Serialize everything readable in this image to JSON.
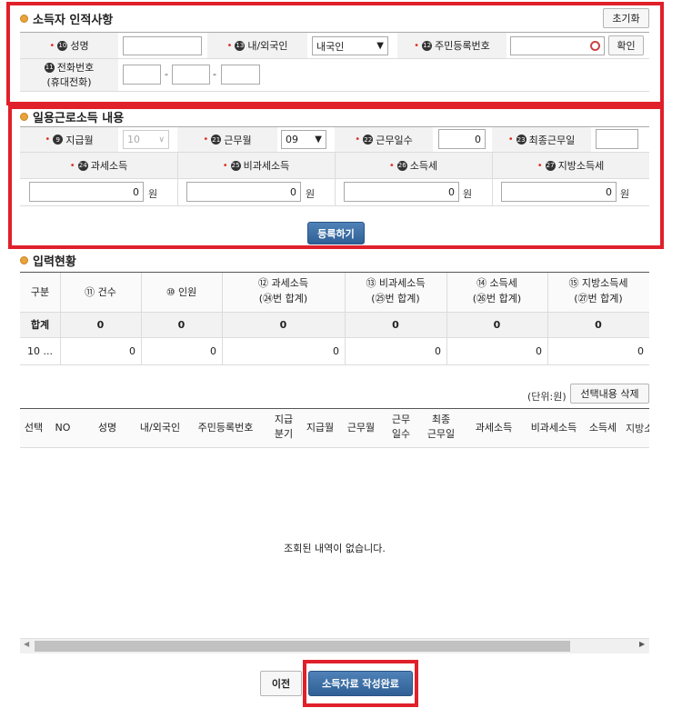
{
  "section1": {
    "title": "소득자 인적사항",
    "reset_button": "초기화",
    "name_label": "성명",
    "name_num": "⑩",
    "nationality_label": "내/외국인",
    "nationality_num": "⑬",
    "nationality_value": "내국인",
    "resident_label": "주민등록번호",
    "resident_num": "⑫",
    "confirm_button": "확인",
    "phone_label_1": "전화번호",
    "phone_label_2": "(휴대전화)",
    "phone_num": "⑪",
    "dash": "-"
  },
  "section2": {
    "title": "일용근로소득 내용",
    "paymonth_label": "지급월",
    "paymonth_num": "⑨",
    "paymonth_value": "10",
    "workmonth_label": "근무월",
    "workmonth_num": "㉑",
    "workmonth_value": "09",
    "workdays_label": "근무일수",
    "workdays_num": "㉒",
    "workdays_value": "0",
    "lastday_label": "최종근무일",
    "lastday_num": "㉓",
    "taxable_label": "과세소득",
    "taxable_num": "㉔",
    "taxable_value": "0",
    "nontax_label": "비과세소득",
    "nontax_num": "㉕",
    "nontax_value": "0",
    "incometax_label": "소득세",
    "incometax_num": "㉖",
    "incometax_value": "0",
    "localtax_label": "지방소득세",
    "localtax_num": "㉗",
    "localtax_value": "0",
    "won": "원",
    "register_button": "등록하기"
  },
  "section3": {
    "title": "입력현황",
    "headers": [
      "구분",
      "⑪ 건수",
      "⑩ 인원",
      "⑫ 과세소득",
      "(㉔번 합계)",
      "⑬ 비과세소득",
      "(㉕번 합계)",
      "⑭ 소득세",
      "(㉖번 합계)",
      "⑮ 지방소득세",
      "(㉗번 합계)"
    ],
    "sum_row": [
      "합계",
      "0",
      "0",
      "0",
      "0",
      "0",
      "0"
    ],
    "data_row": [
      "10 ...",
      "0",
      "0",
      "0",
      "0",
      "0",
      "0"
    ]
  },
  "list": {
    "unit": "(단위:원)",
    "delete_button": "선택내용 삭제",
    "headers": [
      "선택",
      "NO",
      "성명",
      "내/외국인",
      "주민등록번호",
      "지급",
      "분기",
      "지급월",
      "근무월",
      "근무",
      "일수",
      "최종",
      "근무일",
      "과세소득",
      "비과세소득",
      "소득세",
      "지방소"
    ],
    "empty_message": "조회된 내역이 없습니다."
  },
  "footer": {
    "prev_button": "이전",
    "complete_button": "소득자료 작성완료"
  },
  "colors": {
    "highlight_red": "#e0202a",
    "button_blue": "#3a6ea5",
    "bullet_orange": "#e8a33a"
  }
}
